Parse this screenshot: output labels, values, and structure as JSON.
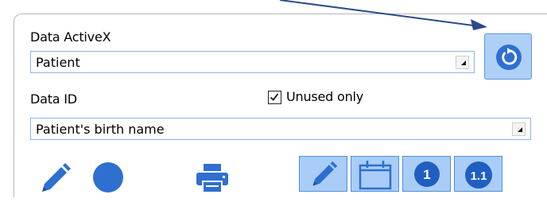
{
  "data_activex": {
    "label": "Data ActiveX",
    "value": "Patient"
  },
  "data_id": {
    "label": "Data ID",
    "value": "Patient's birth name"
  },
  "unused_only": {
    "label": "Unused only",
    "checked": true
  },
  "toolbar": {
    "left_icons": [
      "pencil-icon",
      "circle-icon",
      "printer-icon"
    ],
    "toggle_buttons": [
      {
        "icon": "pencil-icon"
      },
      {
        "icon": "calendar-icon"
      },
      {
        "icon": "number-one-icon",
        "text": "1"
      },
      {
        "icon": "number-decimal-icon",
        "text": "1.1"
      }
    ]
  },
  "colors": {
    "accent_blue": "#2e6fd0",
    "button_fill": "#a9cdf6",
    "button_border": "#4f8edb",
    "field_border": "#8fb4e8"
  }
}
